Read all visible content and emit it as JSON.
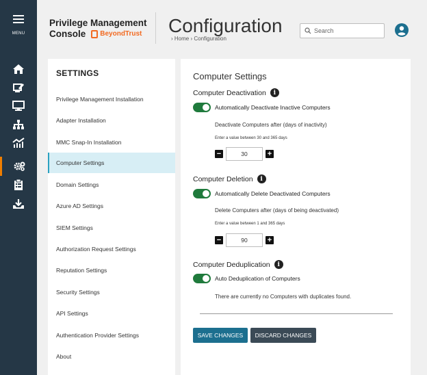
{
  "nav": {
    "menu_label": "MENU"
  },
  "header": {
    "brand_line1": "Privilege Management",
    "brand_line2": "Console",
    "brand_logo": "BeyondTrust",
    "title": "Configuration",
    "breadcrumb": "› Home › Configuration",
    "search_placeholder": "Search"
  },
  "sidebar": {
    "heading": "SETTINGS",
    "items": [
      "Privilege Management Installation",
      "Adapter Installation",
      "MMC Snap-In Installation",
      "Computer Settings",
      "Domain Settings",
      "Azure AD Settings",
      "SIEM Settings",
      "Authorization Request Settings",
      "Reputation Settings",
      "Security Settings",
      "API Settings",
      "Authentication Provider Settings",
      "About"
    ],
    "active_item": "Computer Settings"
  },
  "main": {
    "title": "Computer Settings",
    "deactivation": {
      "heading": "Computer Deactivation",
      "toggle_label": "Automatically Deactivate Inactive Computers",
      "toggle_on": true,
      "field_label": "Deactivate Computers after (days of inactivity)",
      "hint": "Enter a value between 30 and 365 days",
      "value": "30"
    },
    "deletion": {
      "heading": "Computer Deletion",
      "toggle_label": "Automatically Delete Deactivated Computers",
      "toggle_on": true,
      "field_label": "Delete Computers after (days of being deactivated)",
      "hint": "Enter a value between 1 and 365 days",
      "value": "90"
    },
    "deduplication": {
      "heading": "Computer Deduplication",
      "toggle_label": "Auto Deduplication of Computers",
      "toggle_on": true,
      "note": "There are currently no Computers with duplicates found."
    },
    "save_label": "SAVE CHANGES",
    "discard_label": "DISCARD CHANGES"
  },
  "colors": {
    "rail": "#253746",
    "accent": "#f07e00",
    "toggle_on": "#1f7a3c",
    "save_button": "#1c6f8f",
    "discard_button": "#3b4a56",
    "active_item_bg": "#d7eef5"
  }
}
